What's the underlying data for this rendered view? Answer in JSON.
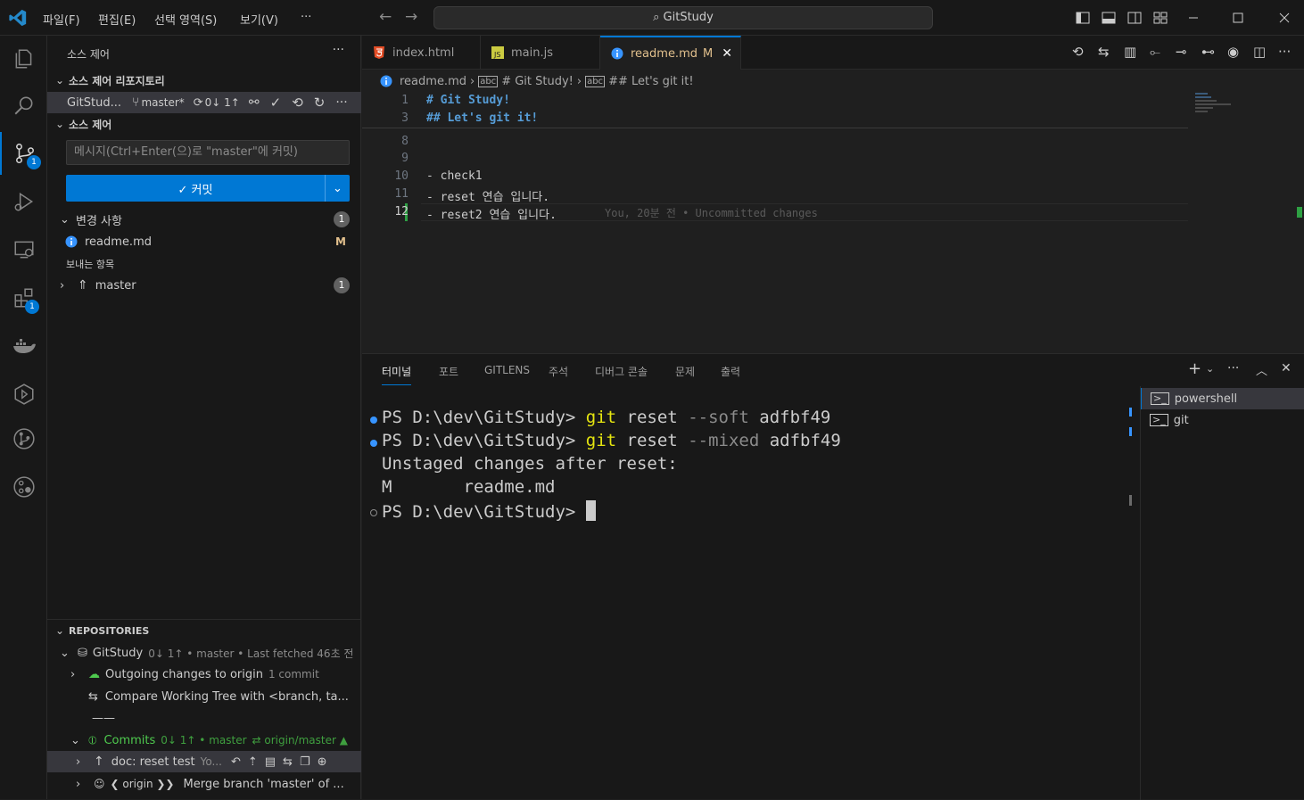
{
  "titlebar": {
    "menus": [
      "파일(F)",
      "편집(E)",
      "선택 영역(S)",
      "보기(V)",
      "···"
    ],
    "search": "GitStudy"
  },
  "activity": {
    "scm_badge": "1",
    "extensions_badge": "1"
  },
  "sidebar": {
    "title": "소스 제어",
    "more": "···",
    "repos_header": "소스 제어 리포지토리",
    "repo_row": {
      "name": "GitStud...",
      "branch": "master*",
      "sync": "0↓ 1↑"
    },
    "scm_header": "소스 제어",
    "commit_placeholder": "메시지(Ctrl+Enter(으)로 \"master\"에 커밋)",
    "commit_label": "✓ 커밋",
    "changes_header": "변경 사항",
    "changes_count": "1",
    "changed_file": "readme.md",
    "changed_status": "M",
    "outgoing_header": "보내는 항목",
    "outgoing_item": "master",
    "outgoing_count": "1",
    "repositories_header": "REPOSITORIES",
    "gl_repo_name": "GitStudy",
    "gl_repo_meta": "0↓ 1↑ • master • Last fetched 46초 전",
    "gl_outgoing": "Outgoing changes to origin",
    "gl_outgoing_meta": "1 commit",
    "gl_compare": "Compare Working Tree with <branch, ta...",
    "gl_divider": "——",
    "gl_commits": "Commits",
    "gl_commits_meta": "0↓ 1↑ • master",
    "gl_commits_upstream": "⇄  origin/master ▲",
    "gl_commit1": "doc: reset test",
    "gl_commit1_author": "Yo...",
    "gl_commit2_tag": "❮ origin ❯❯",
    "gl_commit2": "Merge branch 'master' of ..."
  },
  "tabs": [
    {
      "label": "index.html",
      "icon": "html5-icon"
    },
    {
      "label": "main.js",
      "icon": "js-icon"
    },
    {
      "label": "readme.md",
      "icon": "info-icon",
      "modified": "M"
    }
  ],
  "breadcrumb": {
    "file": "readme.md",
    "h1": "# Git Study!",
    "h2": "## Let's git it!"
  },
  "editor": {
    "sticky": [
      {
        "ln": "1",
        "text": "# Git Study!"
      },
      {
        "ln": "3",
        "text": "## Let's git it!"
      }
    ],
    "lines": [
      {
        "ln": "8",
        "text": ""
      },
      {
        "ln": "9",
        "text": ""
      },
      {
        "ln": "10",
        "text": "- check1"
      },
      {
        "ln": "11",
        "text": "- reset 연습 입니다."
      },
      {
        "ln": "12",
        "text": "- reset2 연습 입니다."
      }
    ],
    "blame": "You, 20분 전 • Uncommitted changes"
  },
  "panel": {
    "tabs": [
      "터미널",
      "포트",
      "GITLENS",
      "주석",
      "디버그 콘솔",
      "문제",
      "출력"
    ],
    "terminal": {
      "l1_prompt": "PS D:\\dev\\GitStudy> ",
      "l1_cmd": "git",
      "l1_a": " reset ",
      "l1_flag": "--soft",
      "l1_b": " adfbf49",
      "l2_prompt": "PS D:\\dev\\GitStudy> ",
      "l2_cmd": "git",
      "l2_a": " reset ",
      "l2_flag": "--mixed",
      "l2_b": " adfbf49",
      "l3": "Unstaged changes after reset:",
      "l4": "M       readme.md",
      "l5_prompt": "PS D:\\dev\\GitStudy> "
    },
    "terminals": [
      "powershell",
      "git"
    ]
  },
  "colors": {
    "accent": "#0078d4",
    "background": "#1f1f1f",
    "yellow_cmd": "#e5e510",
    "added_gutter": "#2ea043"
  }
}
